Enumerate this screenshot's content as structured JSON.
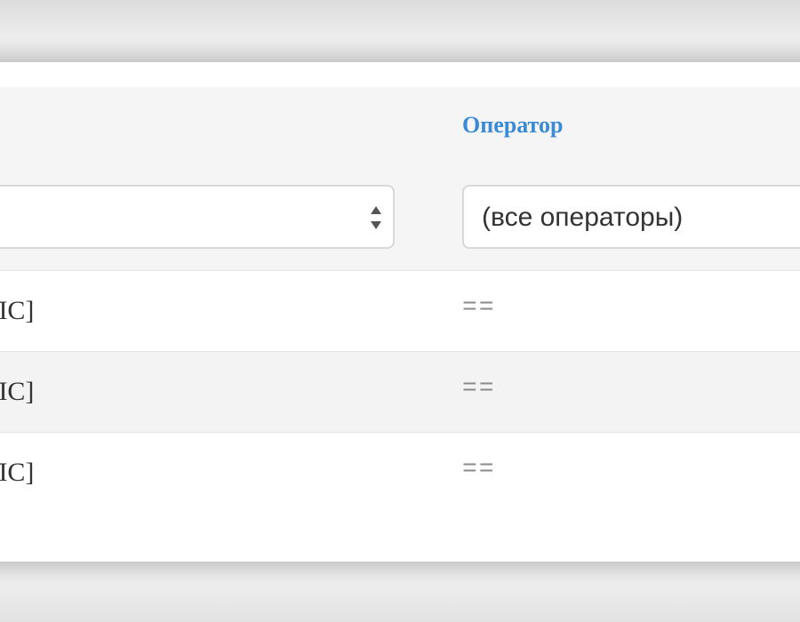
{
  "table": {
    "columns": [
      {
        "label": ""
      },
      {
        "label": "Оператор"
      }
    ],
    "filters": {
      "left": {
        "value": ""
      },
      "right": {
        "value": "(все операторы)"
      }
    },
    "rows": [
      {
        "left": "[ЛС]",
        "right": "=="
      },
      {
        "left": "[ЛС]",
        "right": "=="
      },
      {
        "left": "[ЛС]",
        "right": "=="
      }
    ]
  },
  "icons": {
    "select_stepper": "updown-arrows-icon"
  }
}
